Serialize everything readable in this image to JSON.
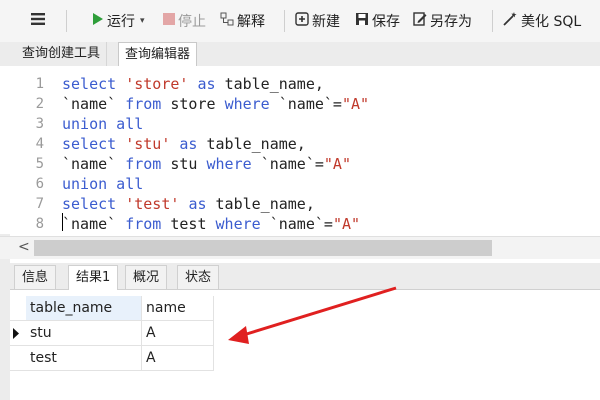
{
  "toolbar": {
    "run_label": "运行",
    "stop_label": "停止",
    "explain_label": "解释",
    "new_label": "新建",
    "save_label": "保存",
    "saveas_label": "另存为",
    "beautify_label": "美化 SQL"
  },
  "editor_tabs": {
    "builder": "查询创建工具",
    "editor": "查询编辑器"
  },
  "code": {
    "line_numbers": [
      "1",
      "2",
      "3",
      "4",
      "5",
      "6",
      "7",
      "8"
    ],
    "l1": {
      "k1": "select",
      "s1": "'store'",
      "k2": "as",
      "t": "table_name,"
    },
    "l2": {
      "t1": "`name`",
      "k1": "from",
      "t2": "store",
      "k2": "where",
      "t3": "`name`=",
      "s1": "\"A\""
    },
    "l3": {
      "k1": "union all"
    },
    "l4": {
      "k1": "select",
      "s1": "'stu'",
      "k2": "as",
      "t": "table_name,"
    },
    "l5": {
      "t1": "`name`",
      "k1": "from",
      "t2": "stu",
      "k2": "where",
      "t3": "`name`=",
      "s1": "\"A\""
    },
    "l6": {
      "k1": "union all"
    },
    "l7": {
      "k1": "select",
      "s1": "'test'",
      "k2": "as",
      "t": "table_name,"
    },
    "l8": {
      "t1": "`name`",
      "k1": "from",
      "t2": "test",
      "k2": "where",
      "t3": "`name`=",
      "s1": "\"A\""
    }
  },
  "result_tabs": {
    "info": "信息",
    "result1": "结果1",
    "overview": "概况",
    "status": "状态"
  },
  "result": {
    "columns": [
      "table_name",
      "name"
    ],
    "rows": [
      [
        "stu",
        "A"
      ],
      [
        "test",
        "A"
      ]
    ]
  },
  "colors": {
    "keyword": "#3b5ccf",
    "string": "#c0392b",
    "run_icon": "#2e9e3a",
    "annotation_arrow": "#e02020"
  }
}
